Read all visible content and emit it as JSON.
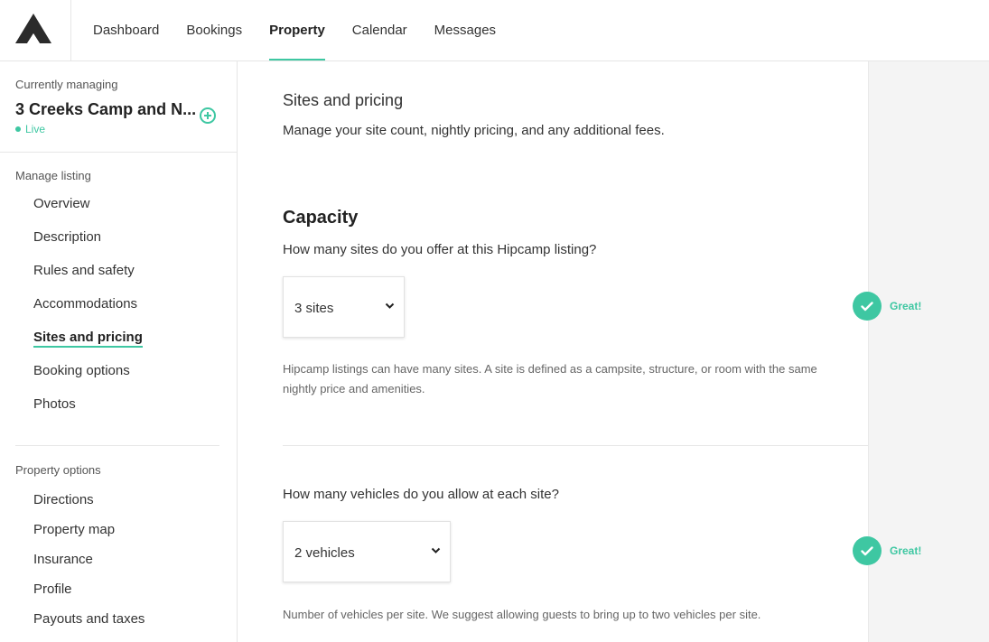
{
  "nav": {
    "items": [
      {
        "label": "Dashboard"
      },
      {
        "label": "Bookings"
      },
      {
        "label": "Property"
      },
      {
        "label": "Calendar"
      },
      {
        "label": "Messages"
      }
    ],
    "active": "Property"
  },
  "sidebar": {
    "currently_managing_label": "Currently managing",
    "listing_name": "3 Creeks Camp and N...",
    "status": "Live",
    "manage_listing_label": "Manage listing",
    "manage_items": [
      {
        "label": "Overview"
      },
      {
        "label": "Description"
      },
      {
        "label": "Rules and safety"
      },
      {
        "label": "Accommodations"
      },
      {
        "label": "Sites and pricing"
      },
      {
        "label": "Booking options"
      },
      {
        "label": "Photos"
      }
    ],
    "active_item": "Sites and pricing",
    "property_options_label": "Property options",
    "property_items": [
      {
        "label": "Directions"
      },
      {
        "label": "Property map"
      },
      {
        "label": "Insurance"
      },
      {
        "label": "Profile"
      },
      {
        "label": "Payouts and taxes"
      }
    ]
  },
  "main": {
    "section_title": "Sites and pricing",
    "section_desc": "Manage your site count, nightly pricing, and any additional fees.",
    "capacity_title": "Capacity",
    "sites_question": "How many sites do you offer at this Hipcamp listing?",
    "sites_value": "3 sites",
    "sites_hint": "Hipcamp listings can have many sites. A site is defined as a campsite, structure, or room with the same nightly price and amenities.",
    "vehicles_question": "How many vehicles do you allow at each site?",
    "vehicles_value": "2 vehicles",
    "vehicles_hint": "Number of vehicles per site. We suggest allowing guests to bring up to two vehicles per site."
  },
  "feedback": {
    "great_label": "Great!"
  },
  "colors": {
    "accent": "#3ec7a2"
  }
}
